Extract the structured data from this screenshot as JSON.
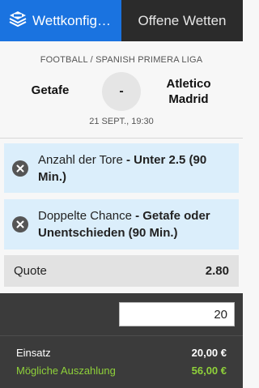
{
  "tabs": {
    "active_label": "Wettkonfigu…",
    "inactive_label": "Offene Wetten"
  },
  "match": {
    "league": "FOOTBALL / SPANISH PRIMERA LIGA",
    "home_team": "Getafe",
    "away_team_line1": "Atletico",
    "away_team_line2": "Madrid",
    "score": "-",
    "datetime": "21 SEPT., 19:30"
  },
  "selections": [
    {
      "market": "Anzahl der Tore",
      "separator": " - ",
      "pick": "Unter 2.5 (90 Min.)"
    },
    {
      "market": "Doppelte Chance",
      "separator": " - ",
      "pick": "Getafe oder Unentschieden (90 Min.)"
    }
  ],
  "quote": {
    "label": "Quote",
    "value": "2.80"
  },
  "stake": {
    "input_value": "20",
    "einsatz_label": "Einsatz",
    "einsatz_value": "20,00 €",
    "payout_label": "Mögliche Auszahlung",
    "payout_value": "56,00 €"
  },
  "colors": {
    "active_tab": "#1a73e0",
    "inactive_tab": "#2b2b2b",
    "selection_bg": "#dbeefb",
    "payout_text": "#8fd13a",
    "panel_bg": "#3b3b3b"
  },
  "icons": {
    "active_tab_icon": "betslip-stack-icon",
    "remove_icon": "close-circle-icon"
  }
}
